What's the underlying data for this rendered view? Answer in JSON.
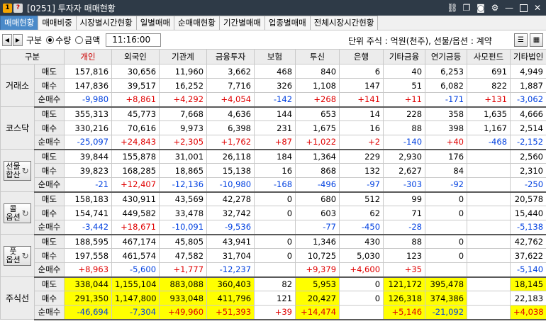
{
  "window": {
    "badge1": "1",
    "badge2": "?",
    "title": "[0251] 투자자 매매현황"
  },
  "icons": [
    "link-icon",
    "copy-icon",
    "camera-icon",
    "settings-icon",
    "minimize-icon",
    "maximize-icon",
    "close-icon"
  ],
  "tabs": [
    "매매현황",
    "매매비중",
    "시장별시간현황",
    "일별매매",
    "순매매현황",
    "기간별매매",
    "업종별매매",
    "전체시장시간현황"
  ],
  "toolbar": {
    "gubun": "구분",
    "opt_qty": "수량",
    "opt_amt": "금액",
    "time": "11:16:00",
    "unit": "단위 주식 : 억원(천주), 선물/옵션 : 계약"
  },
  "columns": [
    "구분",
    "개인",
    "외국인",
    "기관계",
    "금융투자",
    "보험",
    "투신",
    "은행",
    "기타금융",
    "연기금등",
    "사모펀드",
    "기타법인"
  ],
  "groups": [
    {
      "name": "거래소",
      "button": false,
      "rows": [
        {
          "label": "매도",
          "values": [
            "157,816",
            "30,656",
            "11,960",
            "3,662",
            "468",
            "840",
            "6",
            "40",
            "6,253",
            "691",
            "4,949"
          ]
        },
        {
          "label": "매수",
          "values": [
            "147,836",
            "39,517",
            "16,252",
            "7,716",
            "326",
            "1,108",
            "147",
            "51",
            "6,082",
            "822",
            "1,887"
          ]
        },
        {
          "label": "순매수",
          "values": [
            "-9,980",
            "+8,861",
            "+4,292",
            "+4,054",
            "-142",
            "+268",
            "+141",
            "+11",
            "-171",
            "+131",
            "-3,062"
          ]
        }
      ]
    },
    {
      "name": "코스닥",
      "button": false,
      "rows": [
        {
          "label": "매도",
          "values": [
            "355,313",
            "45,773",
            "7,668",
            "4,636",
            "144",
            "653",
            "14",
            "228",
            "358",
            "1,635",
            "4,666"
          ]
        },
        {
          "label": "매수",
          "values": [
            "330,216",
            "70,616",
            "9,973",
            "6,398",
            "231",
            "1,675",
            "16",
            "88",
            "398",
            "1,167",
            "2,514"
          ]
        },
        {
          "label": "순매수",
          "values": [
            "-25,097",
            "+24,843",
            "+2,305",
            "+1,762",
            "+87",
            "+1,022",
            "+2",
            "-140",
            "+40",
            "-468",
            "-2,152"
          ]
        }
      ]
    },
    {
      "name": "선물\n합산",
      "button": true,
      "rows": [
        {
          "label": "매도",
          "values": [
            "39,844",
            "155,878",
            "31,001",
            "26,118",
            "184",
            "1,364",
            "229",
            "2,930",
            "176",
            "",
            "2,560"
          ]
        },
        {
          "label": "매수",
          "values": [
            "39,823",
            "168,285",
            "18,865",
            "15,138",
            "16",
            "868",
            "132",
            "2,627",
            "84",
            "",
            "2,310"
          ]
        },
        {
          "label": "순매수",
          "values": [
            "-21",
            "+12,407",
            "-12,136",
            "-10,980",
            "-168",
            "-496",
            "-97",
            "-303",
            "-92",
            "",
            "-250"
          ]
        }
      ]
    },
    {
      "name": "콜\n옵션",
      "button": true,
      "rows": [
        {
          "label": "매도",
          "values": [
            "158,183",
            "430,911",
            "43,569",
            "42,278",
            "0",
            "680",
            "512",
            "99",
            "0",
            "",
            "20,578"
          ]
        },
        {
          "label": "매수",
          "values": [
            "154,741",
            "449,582",
            "33,478",
            "32,742",
            "0",
            "603",
            "62",
            "71",
            "0",
            "",
            "15,440"
          ]
        },
        {
          "label": "순매수",
          "values": [
            "-3,442",
            "+18,671",
            "-10,091",
            "-9,536",
            "",
            "-77",
            "-450",
            "-28",
            "",
            "",
            "-5,138"
          ]
        }
      ]
    },
    {
      "name": "풋\n옵션",
      "button": true,
      "rows": [
        {
          "label": "매도",
          "values": [
            "188,595",
            "467,174",
            "45,805",
            "43,941",
            "0",
            "1,346",
            "430",
            "88",
            "0",
            "",
            "42,762"
          ]
        },
        {
          "label": "매수",
          "values": [
            "197,558",
            "461,574",
            "47,582",
            "31,704",
            "0",
            "10,725",
            "5,030",
            "123",
            "0",
            "",
            "37,622"
          ]
        },
        {
          "label": "순매수",
          "values": [
            "+8,963",
            "-5,600",
            "+1,777",
            "-12,237",
            "",
            "+9,379",
            "+4,600",
            "+35",
            "",
            "",
            "-5,140"
          ]
        }
      ]
    },
    {
      "name": "주식선",
      "button": false,
      "rows": [
        {
          "label": "매도",
          "values": [
            "338,044",
            "1,155,104",
            "883,088",
            "360,403",
            "82",
            "5,953",
            "0",
            "121,172",
            "395,478",
            "",
            "18,145"
          ],
          "highlight": [
            0,
            1,
            2,
            3,
            5,
            7,
            8,
            10
          ]
        },
        {
          "label": "매수",
          "values": [
            "291,350",
            "1,147,800",
            "933,048",
            "411,796",
            "121",
            "20,427",
            "0",
            "126,318",
            "374,386",
            "",
            "22,183"
          ],
          "highlight": [
            0,
            1,
            2,
            3,
            5,
            7,
            8
          ]
        },
        {
          "label": "순매수",
          "values": [
            "-46,694",
            "-7,304",
            "+49,960",
            "+51,393",
            "+39",
            "+14,474",
            "",
            "+5,146",
            "-21,092",
            "",
            "+4,038"
          ],
          "highlight": [
            0,
            1,
            2,
            3,
            5,
            7,
            8,
            10
          ]
        }
      ]
    }
  ]
}
